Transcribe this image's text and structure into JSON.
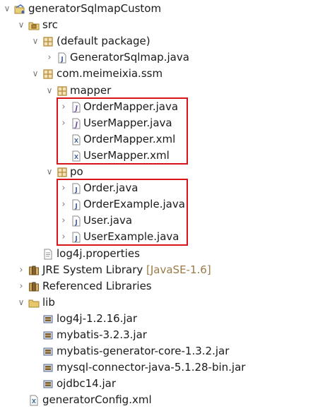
{
  "tree": [
    {
      "label": "generatorSqlmapCustom",
      "icon": "project-icon",
      "name": "tree-item-project",
      "twisty": "open",
      "depth": 0
    },
    {
      "label": "src",
      "icon": "source-folder-icon",
      "name": "tree-item-src",
      "twisty": "open",
      "depth": 1
    },
    {
      "label": "(default package)",
      "icon": "package-icon",
      "name": "tree-item-default-package",
      "twisty": "open",
      "depth": 2
    },
    {
      "label": "GeneratorSqlmap.java",
      "icon": "java-file-icon",
      "name": "tree-item-generatorsqlmap-java",
      "twisty": "closed",
      "depth": 3
    },
    {
      "label": "com.meimeixia.ssm",
      "icon": "package-icon",
      "name": "tree-item-com-meimeixia-ssm",
      "twisty": "open",
      "depth": 2
    },
    {
      "label": "mapper",
      "icon": "package-icon",
      "name": "tree-item-mapper-package",
      "twisty": "open",
      "depth": 3
    },
    {
      "label": "OrderMapper.java",
      "icon": "java-interface-icon",
      "name": "tree-item-ordermapper-java",
      "twisty": "closed",
      "depth": 4
    },
    {
      "label": "UserMapper.java",
      "icon": "java-interface-icon",
      "name": "tree-item-usermapper-java",
      "twisty": "closed",
      "depth": 4
    },
    {
      "label": "OrderMapper.xml",
      "icon": "xml-file-icon",
      "name": "tree-item-ordermapper-xml",
      "twisty": "none",
      "depth": 4
    },
    {
      "label": "UserMapper.xml",
      "icon": "xml-file-icon",
      "name": "tree-item-usermapper-xml",
      "twisty": "none",
      "depth": 4
    },
    {
      "label": "po",
      "icon": "package-icon",
      "name": "tree-item-po-package",
      "twisty": "open",
      "depth": 3
    },
    {
      "label": "Order.java",
      "icon": "java-file-icon",
      "name": "tree-item-order-java",
      "twisty": "closed",
      "depth": 4
    },
    {
      "label": "OrderExample.java",
      "icon": "java-file-icon",
      "name": "tree-item-orderexample-java",
      "twisty": "closed",
      "depth": 4
    },
    {
      "label": "User.java",
      "icon": "java-file-icon",
      "name": "tree-item-user-java",
      "twisty": "closed",
      "depth": 4
    },
    {
      "label": "UserExample.java",
      "icon": "java-file-icon",
      "name": "tree-item-userexample-java",
      "twisty": "closed",
      "depth": 4
    },
    {
      "label": "log4j.properties",
      "icon": "properties-file-icon",
      "name": "tree-item-log4j-properties",
      "twisty": "none",
      "depth": 2
    },
    {
      "label": "JRE System Library",
      "icon": "library-icon",
      "name": "tree-item-jre-system-library",
      "twisty": "closed",
      "depth": 1,
      "decoration": "[JavaSE-1.6]"
    },
    {
      "label": "Referenced Libraries",
      "icon": "library-icon",
      "name": "tree-item-referenced-libraries",
      "twisty": "closed",
      "depth": 1
    },
    {
      "label": "lib",
      "icon": "folder-icon",
      "name": "tree-item-lib-folder",
      "twisty": "open",
      "depth": 1
    },
    {
      "label": "log4j-1.2.16.jar",
      "icon": "jar-file-icon",
      "name": "tree-item-log4j-jar",
      "twisty": "none",
      "depth": 2
    },
    {
      "label": "mybatis-3.2.3.jar",
      "icon": "jar-file-icon",
      "name": "tree-item-mybatis-jar",
      "twisty": "none",
      "depth": 2
    },
    {
      "label": "mybatis-generator-core-1.3.2.jar",
      "icon": "jar-file-icon",
      "name": "tree-item-mybatis-generator-core-jar",
      "twisty": "none",
      "depth": 2
    },
    {
      "label": "mysql-connector-java-5.1.28-bin.jar",
      "icon": "jar-file-icon",
      "name": "tree-item-mysql-connector-jar",
      "twisty": "none",
      "depth": 2
    },
    {
      "label": "ojdbc14.jar",
      "icon": "jar-file-icon",
      "name": "tree-item-ojdbc14-jar",
      "twisty": "none",
      "depth": 2
    },
    {
      "label": "generatorConfig.xml",
      "icon": "xml-file-icon",
      "name": "tree-item-generatorconfig-xml",
      "twisty": "none",
      "depth": 1
    }
  ],
  "highlights": [
    {
      "name": "highlight-mapper-files",
      "from": 6,
      "to": 9
    },
    {
      "name": "highlight-po-files",
      "from": 11,
      "to": 14
    }
  ],
  "colors": {
    "highlight_border": "#d7141a",
    "decoration_text": "#9a7a44",
    "java_icon": "#3b5fa8",
    "package_icon": "#b58a3a",
    "folder_icon": "#e8c66a",
    "jar_icon": "#7d5e2e"
  }
}
